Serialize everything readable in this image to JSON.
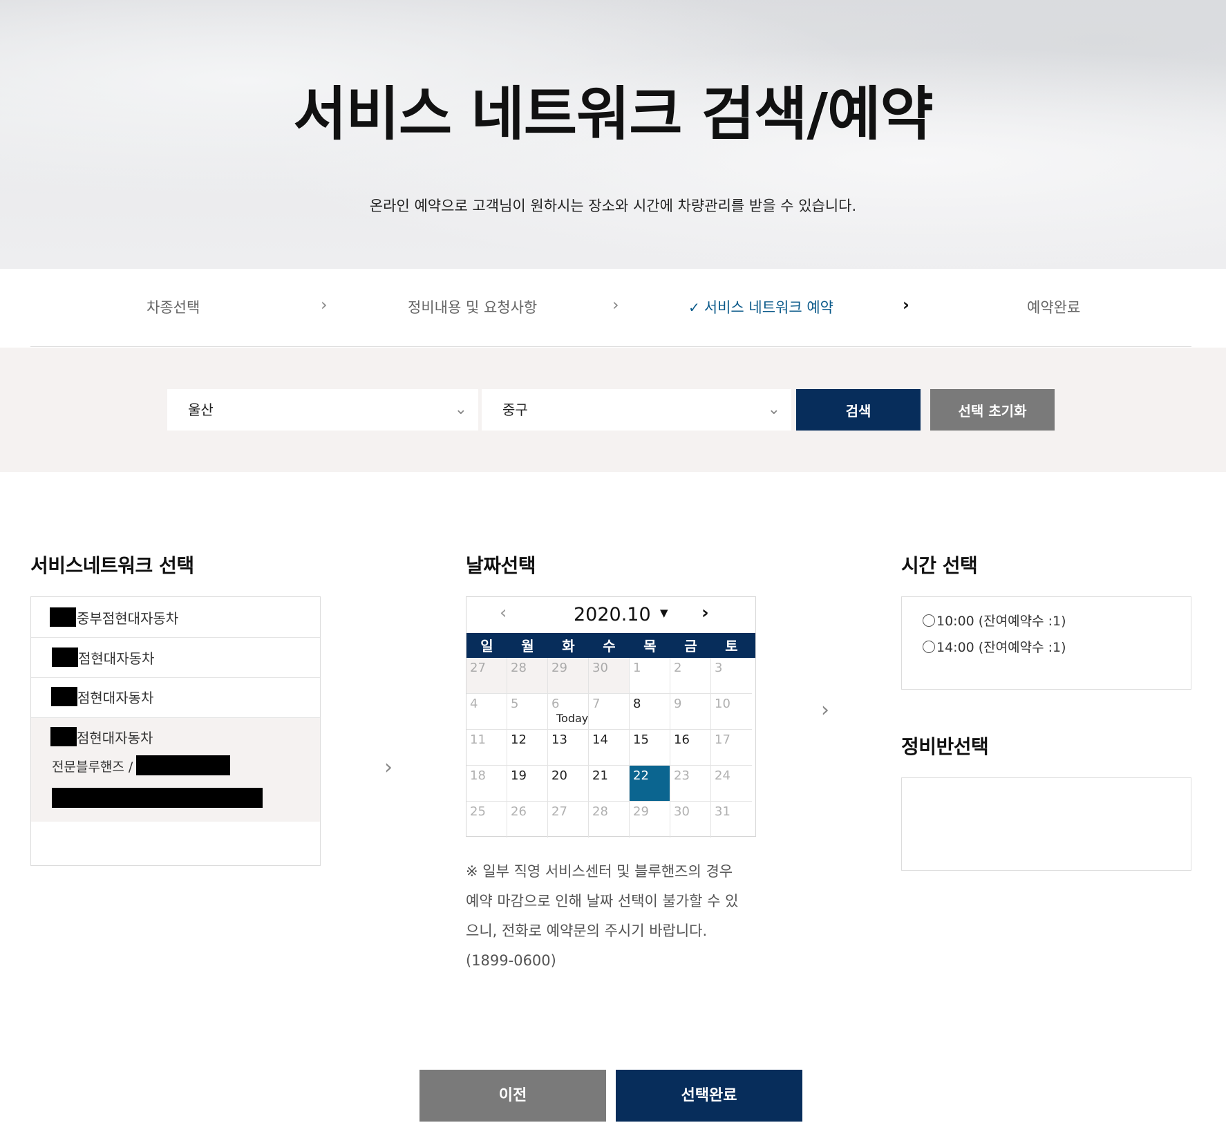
{
  "hero": {
    "title": "서비스 네트워크 검색/예약",
    "subtitle": "온라인 예약으로 고객님이 원하시는 장소와 시간에 차량관리를 받을 수 있습니다."
  },
  "steps": [
    {
      "label": "차종선택",
      "active": false
    },
    {
      "label": "정비내용 및 요청사항",
      "active": false
    },
    {
      "label": "서비스 네트워크 예약",
      "active": true
    },
    {
      "label": "예약완료",
      "active": false
    }
  ],
  "search": {
    "region1": "울산",
    "region2": "중구",
    "search_label": "검색",
    "reset_label": "선택 초기화"
  },
  "network": {
    "title": "서비스네트워크 선택",
    "items": [
      {
        "name": "중부점현대자동차"
      },
      {
        "name": "점현대자동차"
      },
      {
        "name": "점현대자동차"
      },
      {
        "name": "점현대자동차",
        "type": "전문블루핸즈 /"
      }
    ]
  },
  "calendar": {
    "title": "날짜선택",
    "month_label": "2020.10",
    "weekdays": [
      "일",
      "월",
      "화",
      "수",
      "목",
      "금",
      "토"
    ],
    "today_label": "Today",
    "weeks": [
      [
        "27",
        "28",
        "29",
        "30",
        "1",
        "2",
        "3"
      ],
      [
        "4",
        "5",
        "6",
        "7",
        "8",
        "9",
        "10"
      ],
      [
        "11",
        "12",
        "13",
        "14",
        "15",
        "16",
        "17"
      ],
      [
        "18",
        "19",
        "20",
        "21",
        "22",
        "23",
        "24"
      ],
      [
        "25",
        "26",
        "27",
        "28",
        "29",
        "30",
        "31"
      ]
    ],
    "today_day": "6",
    "selected_day": "22"
  },
  "notice": {
    "line1": "※ 일부 직영 서비스센터 및 블루핸즈의 경우",
    "line2": "예약 마감으로 인해 날짜 선택이 불가할 수 있",
    "line3": "으니, 전화로 예약문의 주시기 바랍니다.",
    "line4": "(1899-0600)"
  },
  "time": {
    "title": "시간 선택",
    "options": [
      {
        "label": "10:00 (잔여예약수 :1)"
      },
      {
        "label": "14:00 (잔여예약수 :1)"
      }
    ]
  },
  "bay": {
    "title": "정비반선택"
  },
  "footer": {
    "prev_label": "이전",
    "done_label": "선택완료"
  },
  "colors": {
    "navy": "#072d5b",
    "selected_blue": "#0b6590",
    "gray_button": "#7a7a7a",
    "active_step": "#0b5a8a"
  }
}
